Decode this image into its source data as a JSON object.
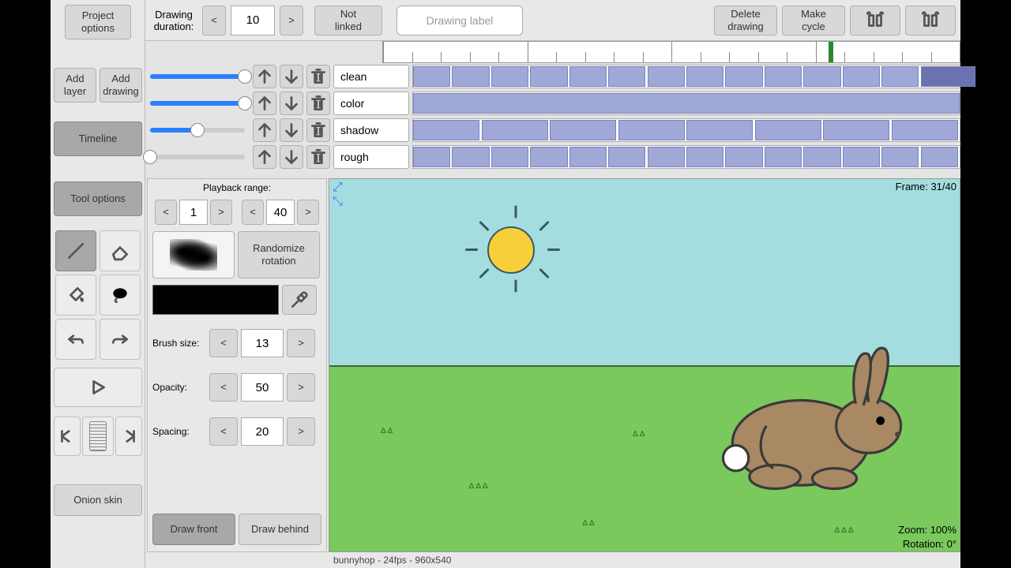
{
  "sidebar": {
    "project_options": "Project\noptions",
    "add_layer": "Add\nlayer",
    "add_drawing": "Add\ndrawing",
    "timeline": "Timeline",
    "tool_options": "Tool options",
    "onion_skin": "Onion skin"
  },
  "topbar": {
    "duration_label": "Drawing\nduration:",
    "duration_value": "10",
    "not_linked": "Not\nlinked",
    "drawing_label_placeholder": "Drawing label",
    "delete_drawing": "Delete\ndrawing",
    "make_cycle": "Make\ncycle"
  },
  "layers": [
    {
      "name": "clean",
      "slider": 100
    },
    {
      "name": "color",
      "slider": 100
    },
    {
      "name": "shadow",
      "slider": 50
    },
    {
      "name": "rough",
      "slider": 0
    }
  ],
  "toolpanel": {
    "playback_range_label": "Playback range:",
    "range_start": "1",
    "range_end": "40",
    "randomize_rotation": "Randomize\nrotation",
    "brush_size_label": "Brush size:",
    "brush_size": "13",
    "opacity_label": "Opacity:",
    "opacity": "50",
    "spacing_label": "Spacing:",
    "spacing": "20",
    "draw_front": "Draw front",
    "draw_behind": "Draw behind"
  },
  "canvas": {
    "frame_info": "Frame: 31/40",
    "zoom_info": "Zoom: 100%",
    "rotation_info": "Rotation: 0°"
  },
  "status": {
    "text": "bunnyhop - 24fps - 960x540"
  }
}
